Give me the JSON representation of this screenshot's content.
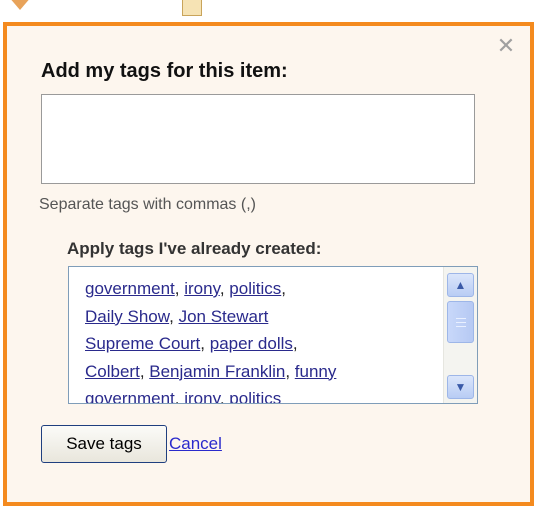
{
  "popup": {
    "title": "Add my tags for this item:",
    "tag_input": {
      "value": "",
      "placeholder": ""
    },
    "hint": "Separate tags with commas (,)",
    "apply_title": "Apply tags I've already created:",
    "existing_tags": [
      {
        "label": "government",
        "sep": ", "
      },
      {
        "label": "irony",
        "sep": ", "
      },
      {
        "label": "politics",
        "sep": ","
      },
      {
        "label": "Daily Show",
        "sep": ", "
      },
      {
        "label": "Jon Stewart",
        "sep": ""
      },
      {
        "label": "Supreme Court",
        "sep": ", "
      },
      {
        "label": "paper dolls",
        "sep": ","
      },
      {
        "label": "Colbert",
        "sep": ", "
      },
      {
        "label": "Benjamin Franklin",
        "sep": ", "
      },
      {
        "label": "funny",
        "sep": ""
      },
      {
        "label": "government",
        "sep": ", "
      },
      {
        "label": "irony",
        "sep": ", "
      },
      {
        "label": "politics",
        "sep": ""
      }
    ],
    "save_label": "Save tags",
    "cancel_label": "Cancel",
    "close_icon": "close-icon"
  },
  "colors": {
    "popup_border": "#f48a1e",
    "popup_background": "#fdf6ee",
    "link": "#2a2a8c"
  }
}
